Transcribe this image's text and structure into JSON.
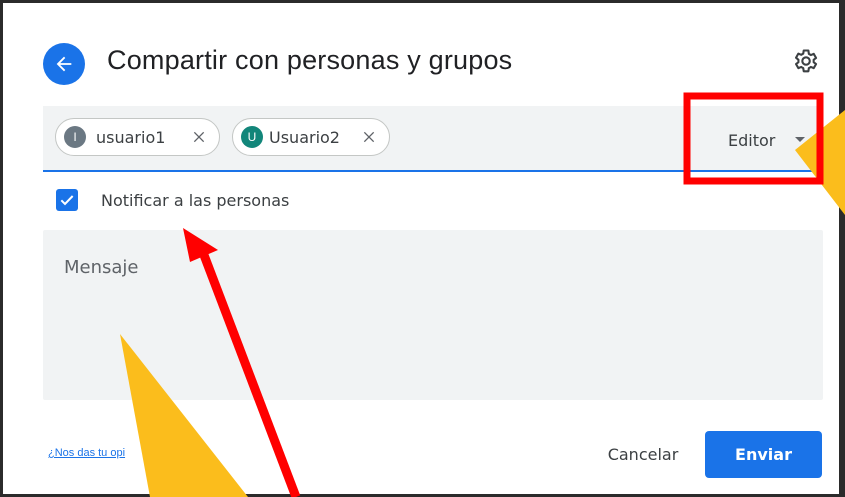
{
  "dialog": {
    "title": "Compartir con personas y grupos"
  },
  "recipients": {
    "chips": [
      {
        "initial": "I",
        "label": "usuario1",
        "avatar_color": "#6b7883"
      },
      {
        "initial": "U",
        "label": "Usuario2",
        "avatar_color": "#12867a"
      }
    ],
    "role_label": "Editor"
  },
  "notify": {
    "checked": true,
    "label": "Notificar a las personas"
  },
  "message": {
    "placeholder": "Mensaje"
  },
  "footer": {
    "feedback_link": "¿Nos das tu opi",
    "cancel_label": "Cancelar",
    "send_label": "Enviar"
  },
  "colors": {
    "accent": "#1a73e8",
    "annotation_red": "#ff0000",
    "annotation_yellow": "#fbbd1c"
  },
  "icons": {
    "back": "arrow-left-icon",
    "settings": "gear-icon",
    "remove": "close-icon",
    "dropdown": "caret-down-icon",
    "check": "checkmark-icon"
  }
}
